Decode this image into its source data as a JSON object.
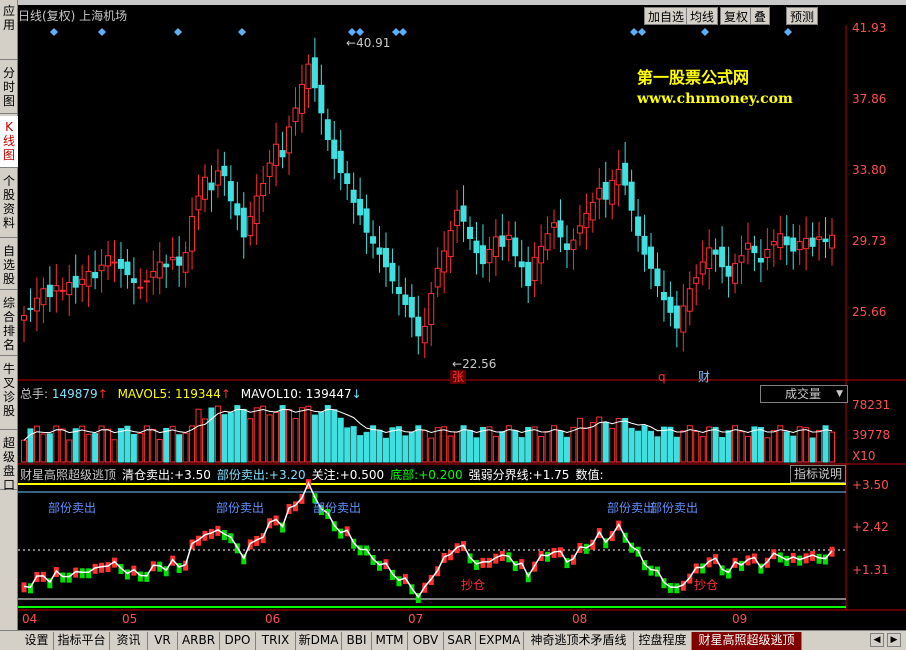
{
  "left_tabs": [
    {
      "label": "应用",
      "active": false
    },
    {
      "label": "分时图",
      "active": false
    },
    {
      "label": "K线图",
      "active": true
    },
    {
      "label": "个股资料",
      "active": false
    },
    {
      "label": "自选股",
      "active": false
    },
    {
      "label": "综合排名",
      "active": false
    },
    {
      "label": "牛叉诊股",
      "active": false
    },
    {
      "label": "超级盘口",
      "active": false
    }
  ],
  "header": {
    "title": "日线(复权)  上海机场",
    "buttons": [
      "加自选",
      "均线",
      "复权",
      "叠",
      "预测"
    ]
  },
  "price_axis": [
    "41.93",
    "37.86",
    "33.80",
    "29.73",
    "25.66"
  ],
  "price_range": [
    22.0,
    42.5
  ],
  "hi_label": "40.91",
  "lo_label": "22.56",
  "watermark": {
    "line1": "第一股票公式网",
    "line2": "www.chnmoney.com"
  },
  "event_badges": [
    {
      "text": "张",
      "color": "#ff3030"
    },
    {
      "text": "q",
      "color": "#ff3030"
    },
    {
      "text": "财",
      "color": "#80c0ff"
    }
  ],
  "volume": {
    "header": {
      "total_label": "总手:",
      "total": "149879",
      "ma5_label": "MAVOL5:",
      "ma5": "119344",
      "ma10_label": "MAVOL10:",
      "ma10": "139447"
    },
    "dropdown": "成交量",
    "axis": [
      "78231",
      "39778",
      "X10"
    ]
  },
  "indicator": {
    "name": "财星高照超级逃顶",
    "items": [
      {
        "label": "清仓卖出:",
        "value": "+3.50",
        "color": "#ffffff"
      },
      {
        "label": "部份卖出:",
        "value": "+3.20",
        "color": "#80e0ff"
      },
      {
        "label": "关注:",
        "value": "+0.500",
        "color": "#ffffff"
      },
      {
        "label": "底部:",
        "value": "+0.200",
        "color": "#00ff00"
      },
      {
        "label": "强弱分界线:",
        "value": "+1.75",
        "color": "#ffffff"
      },
      {
        "label": "数值:",
        "value": "",
        "color": "#ffffff"
      }
    ],
    "help_button": "指标说明",
    "axis": [
      "+3.50",
      "+2.42",
      "+1.31"
    ],
    "sell_labels": [
      "部份卖出",
      "部份卖出",
      "部份卖出",
      "部份卖出",
      "部份卖出"
    ],
    "buy_labels": [
      "抄仓",
      "抄仓"
    ]
  },
  "date_axis": [
    "04",
    "05",
    "06",
    "07",
    "08",
    "09"
  ],
  "bottom_tabs": [
    {
      "label": "设置",
      "active": false
    },
    {
      "label": "指标平台",
      "active": false
    },
    {
      "label": "资讯",
      "active": false
    },
    {
      "label": "VR",
      "active": false
    },
    {
      "label": "ARBR",
      "active": false
    },
    {
      "label": "DPO",
      "active": false
    },
    {
      "label": "TRIX",
      "active": false
    },
    {
      "label": "新DMA",
      "active": false
    },
    {
      "label": "BBI",
      "active": false
    },
    {
      "label": "MTM",
      "active": false
    },
    {
      "label": "OBV",
      "active": false
    },
    {
      "label": "SAR",
      "active": false
    },
    {
      "label": "EXPMA",
      "active": false
    },
    {
      "label": "神奇逃顶术矛盾线",
      "active": false
    },
    {
      "label": "控盘程度",
      "active": false
    },
    {
      "label": "财星高照超级逃顶",
      "active": true
    }
  ],
  "colors": {
    "up": "#ff3030",
    "down": "#40e0e0",
    "axis": "#c00000",
    "yellow": "#ffff00",
    "green": "#00ff00"
  },
  "series": {
    "closes": [
      24.2,
      24.6,
      25.3,
      25.9,
      25.4,
      26.1,
      25.8,
      26.3,
      26.0,
      26.5,
      27.0,
      26.6,
      27.4,
      28.0,
      27.6,
      27.2,
      26.8,
      26.3,
      26.0,
      26.4,
      27.0,
      27.6,
      27.3,
      27.9,
      27.4,
      28.2,
      30.5,
      31.8,
      33.0,
      32.2,
      33.4,
      33.1,
      31.5,
      30.6,
      29.2,
      30.5,
      31.8,
      32.6,
      33.9,
      35.1,
      34.3,
      36.2,
      37.4,
      38.9,
      40.2,
      38.7,
      37.1,
      35.4,
      34.2,
      33.3,
      32.6,
      31.4,
      30.6,
      29.5,
      28.8,
      28.1,
      27.3,
      26.4,
      25.6,
      24.9,
      24.1,
      22.9,
      23.5,
      25.6,
      27.2,
      28.3,
      29.6,
      30.9,
      30.2,
      29.1,
      28.2,
      27.5,
      28.4,
      29.2,
      28.6,
      29.3,
      28.0,
      27.3,
      26.1,
      27.9,
      28.6,
      29.4,
      30.1,
      29.2,
      28.4,
      29.0,
      29.9,
      30.7,
      31.4,
      32.3,
      31.6,
      32.8,
      33.5,
      32.5,
      30.9,
      29.3,
      28.1,
      27.2,
      26.1,
      25.2,
      24.4,
      23.4,
      24.8,
      25.9,
      26.6,
      27.6,
      28.5,
      28.1,
      27.3,
      26.7,
      27.5,
      28.0,
      28.8,
      28.2,
      27.6,
      28.4,
      28.9,
      29.4,
      28.7,
      28.3,
      28.9,
      29.1,
      28.6,
      29.2,
      28.9,
      29.3
    ]
  }
}
